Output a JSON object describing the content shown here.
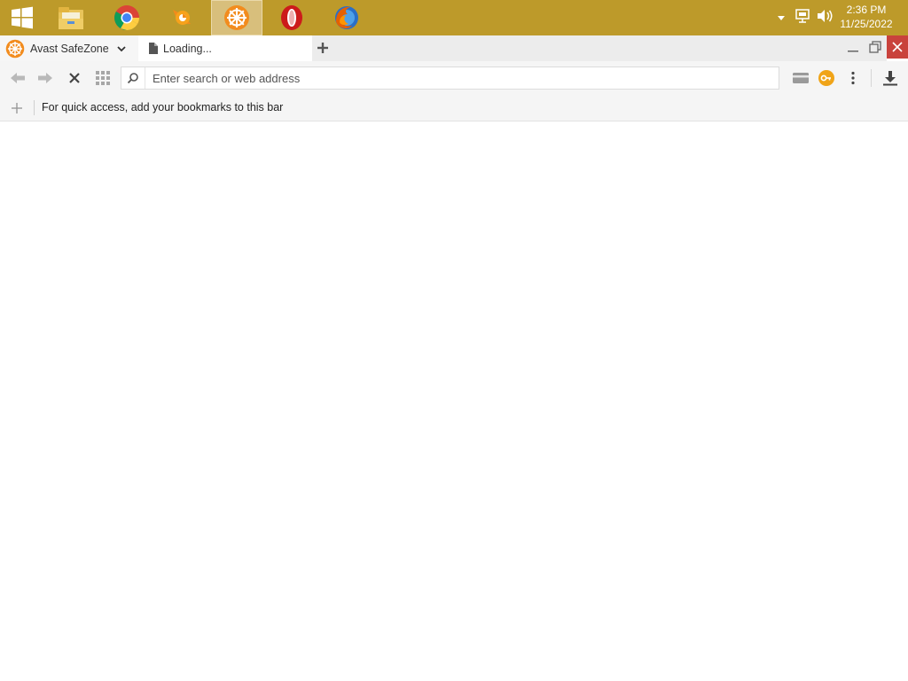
{
  "taskbar": {
    "start_icon": "windows-logo-icon",
    "pinned": [
      {
        "name": "file-explorer",
        "icon": "folder-icon"
      },
      {
        "name": "chrome",
        "icon": "chrome-icon"
      },
      {
        "name": "avast",
        "icon": "avast-icon"
      },
      {
        "name": "avast-safezone",
        "icon": "safezone-icon",
        "active": true
      },
      {
        "name": "opera",
        "icon": "opera-icon"
      },
      {
        "name": "firefox",
        "icon": "firefox-icon"
      }
    ],
    "tray": {
      "icons": [
        "chevron-up-icon",
        "network-icon",
        "volume-icon"
      ],
      "time": "2:36 PM",
      "date": "11/25/2022"
    },
    "colors": {
      "background": "#bd9a2a",
      "active": "#d8bf7c"
    }
  },
  "browser": {
    "profile_label": "Avast SafeZone",
    "tab": {
      "label": "Loading..."
    },
    "toolbar": {
      "url_placeholder": "Enter search or web address",
      "url_value": ""
    },
    "bookmarks_bar": {
      "hint": "For quick access, add your bookmarks to this bar"
    },
    "colors": {
      "accent": "#f0a418",
      "close": "#c9423c"
    }
  }
}
